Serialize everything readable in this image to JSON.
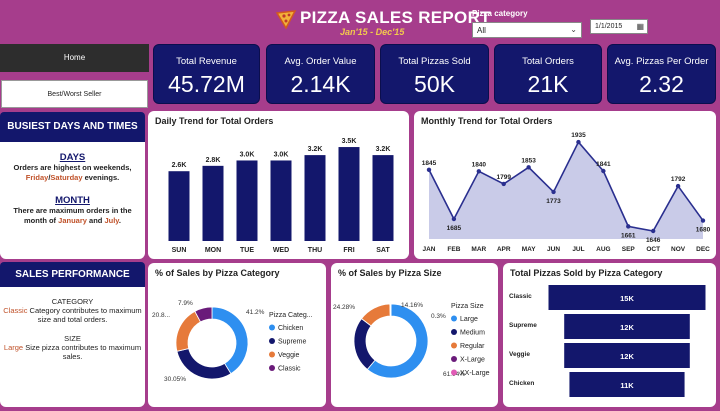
{
  "header": {
    "title": "PIZZA SALES REPORT",
    "subtitle": "Jan'15 - Dec'15",
    "category_filter": {
      "label": "Pizza category",
      "value": "All"
    },
    "date_value": "1/1/2015"
  },
  "nav": {
    "home": "Home",
    "best_worst": "Best/Worst Seller"
  },
  "kpis": [
    {
      "label": "Total Revenue",
      "value": "45.72M"
    },
    {
      "label": "Avg. Order Value",
      "value": "2.14K"
    },
    {
      "label": "Total Pizzas Sold",
      "value": "50K"
    },
    {
      "label": "Total Orders",
      "value": "21K"
    },
    {
      "label": "Avg. Pizzas Per Order",
      "value": "2.32"
    }
  ],
  "busiest": {
    "title": "BUSIEST DAYS AND TIMES",
    "days_heading": "DAYS",
    "days_text_1": "Orders are highest on weekends,",
    "days_hl_1": "Friday",
    "days_sep": "/",
    "days_hl_2": "Saturday",
    "days_text_2": " evenings.",
    "month_heading": "MONTH",
    "month_text_1": "There are maximum orders in the month of ",
    "month_hl_1": "January",
    "month_and": " and ",
    "month_hl_2": "July",
    "month_end": "."
  },
  "performance": {
    "title": "SALES PERFORMANCE",
    "cat_heading": "CATEGORY",
    "cat_hl": "Classic",
    "cat_text": " Category contributes to maximum size and total orders.",
    "size_heading": "SIZE",
    "size_hl": "Large",
    "size_text": " Size pizza contributes to maximum sales."
  },
  "colors": {
    "navy": "#13176c",
    "magenta": "#a63d8c",
    "highlight": "#c0522a",
    "area_fill": "#c9cbe8"
  },
  "chart_data": [
    {
      "type": "bar",
      "title": "Daily Trend for Total Orders",
      "categories": [
        "SUN",
        "MON",
        "TUE",
        "WED",
        "THU",
        "FRI",
        "SAT"
      ],
      "values": [
        2.6,
        2.8,
        3.0,
        3.0,
        3.2,
        3.5,
        3.2
      ],
      "data_labels": [
        "2.6K",
        "2.8K",
        "3.0K",
        "3.0K",
        "3.2K",
        "3.5K",
        "3.2K"
      ],
      "ylim": [
        0,
        3.8
      ]
    },
    {
      "type": "area",
      "title": "Monthly Trend for Total Orders",
      "categories": [
        "JAN",
        "FEB",
        "MAR",
        "APR",
        "MAY",
        "JUN",
        "JUL",
        "AUG",
        "SEP",
        "OCT",
        "NOV",
        "DEC"
      ],
      "values": [
        1845,
        1685,
        1840,
        1799,
        1853,
        1773,
        1935,
        1841,
        1661,
        1646,
        1792,
        1680
      ],
      "ylim": [
        1620,
        1945
      ]
    },
    {
      "type": "pie",
      "title": "% of Sales by Pizza Category",
      "legend_title": "Pizza Categ...",
      "labels": [
        "Chicken",
        "Supreme",
        "Veggie",
        "Classic"
      ],
      "values": [
        41.2,
        30.05,
        20.8,
        7.9
      ],
      "data_labels": [
        "41.2%",
        "30.05%",
        "20.8...",
        "7.9%"
      ],
      "colors": [
        "#2e8ff0",
        "#13176c",
        "#e67a3a",
        "#6a1b7a"
      ]
    },
    {
      "type": "pie",
      "title": "% of Sales by Pizza Size",
      "legend_title": "Pizza Size",
      "labels": [
        "Large",
        "Medium",
        "Regular",
        "X-Large",
        "XX-Large"
      ],
      "values": [
        61.04,
        24.28,
        14.16,
        0.3,
        0.2
      ],
      "data_labels": [
        "61.04%",
        "24.28%",
        "14.16%",
        "0.3%",
        ""
      ],
      "colors": [
        "#2e8ff0",
        "#13176c",
        "#e67a3a",
        "#6a1b7a",
        "#e05bb5"
      ]
    },
    {
      "type": "bar",
      "title": "Total Pizzas Sold by Pizza Category",
      "categories": [
        "Classic",
        "Supreme",
        "Veggie",
        "Chicken"
      ],
      "values": [
        15,
        12,
        12,
        11
      ],
      "data_labels": [
        "15K",
        "12K",
        "12K",
        "11K"
      ]
    }
  ]
}
